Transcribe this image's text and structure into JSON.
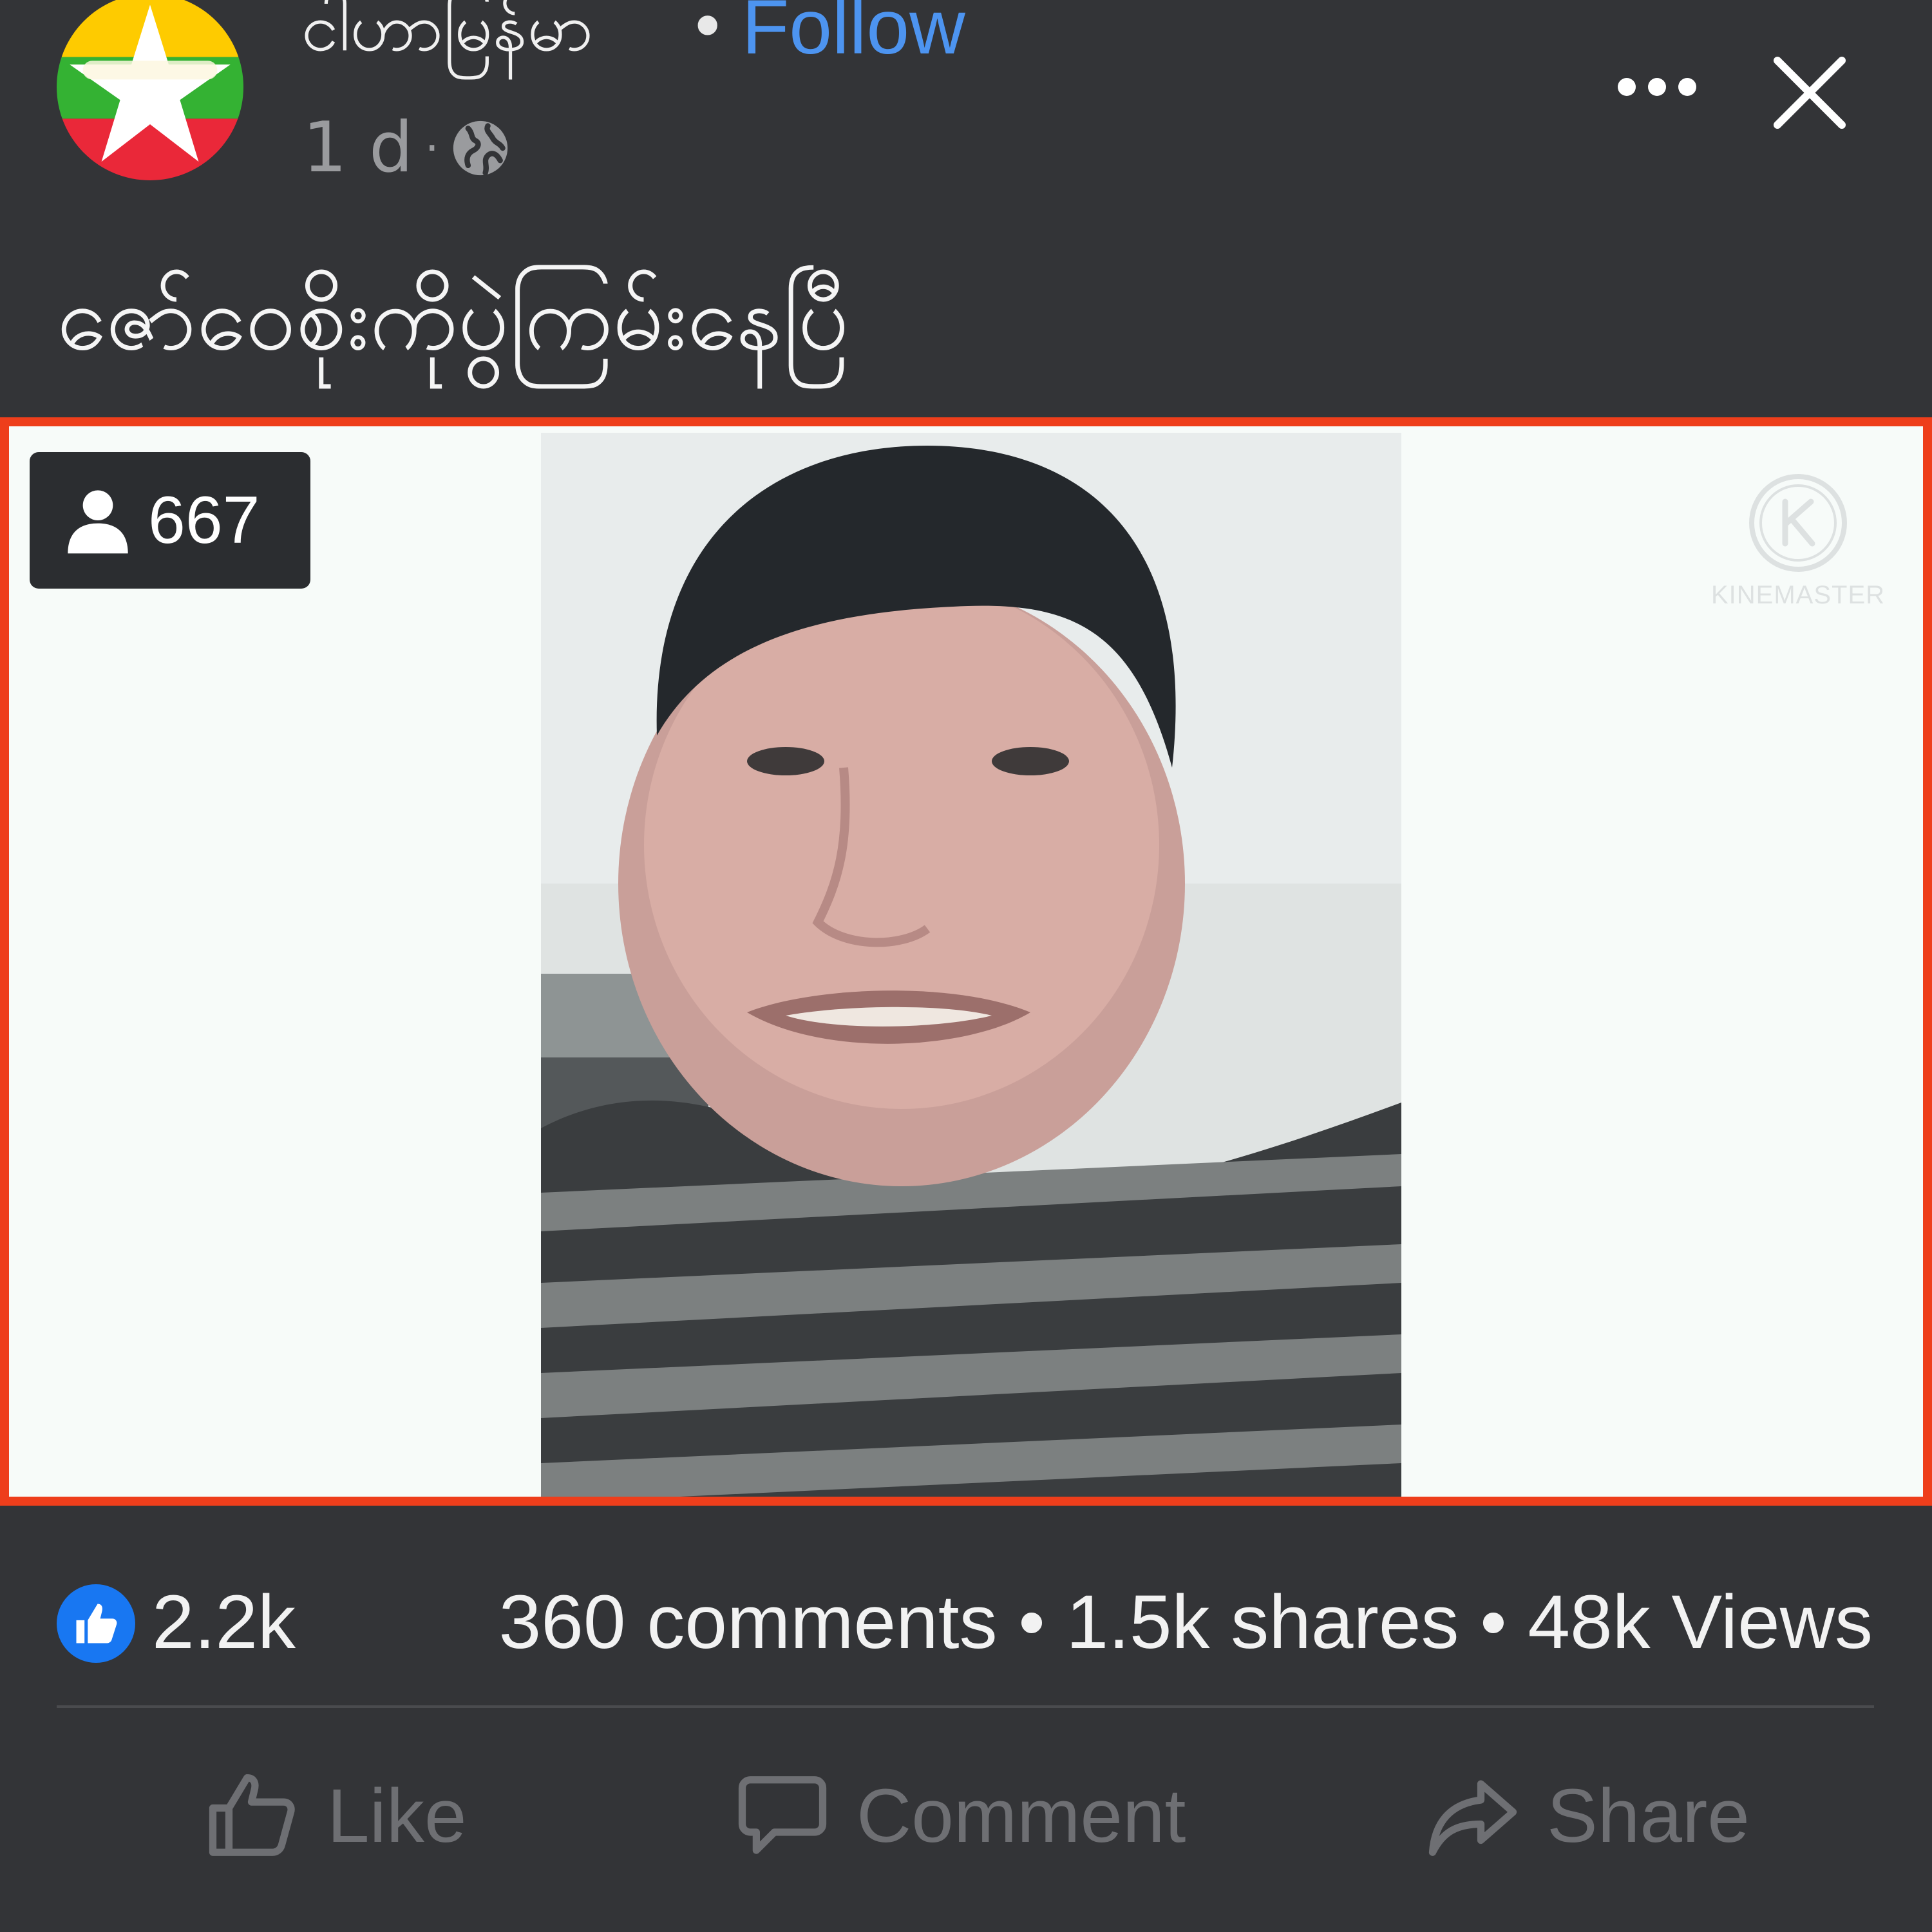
{
  "header": {
    "page_name": "ငါဟာမြန်မာ",
    "dot": "•",
    "follow_label": "Follow",
    "time": "1 d",
    "time_sep": "·",
    "avatar_text": "ငါဟာမြန်မာ",
    "privacy_icon": "globe-icon",
    "more_icon": "more-horizontal-icon",
    "close_icon": "close-icon"
  },
  "post": {
    "caption": "ဇော်ဝေစိုးကိုပွဲကြမ်းနေပြီ"
  },
  "video": {
    "viewer_icon": "person-icon",
    "viewer_count": "667",
    "watermark": "KINEMASTER",
    "border_color": "#ee3e1b"
  },
  "stats": {
    "like_icon": "thumbs-up-badge-icon",
    "like_count": "2.2k",
    "summary": "360 comments • 1.5k shares • 48k Views"
  },
  "actions": {
    "like": "Like",
    "comment": "Comment",
    "share": "Share"
  },
  "colors": {
    "background": "#333437",
    "follow": "#4d94f0",
    "like_badge": "#1877f2",
    "action_muted": "#6e6f73"
  }
}
